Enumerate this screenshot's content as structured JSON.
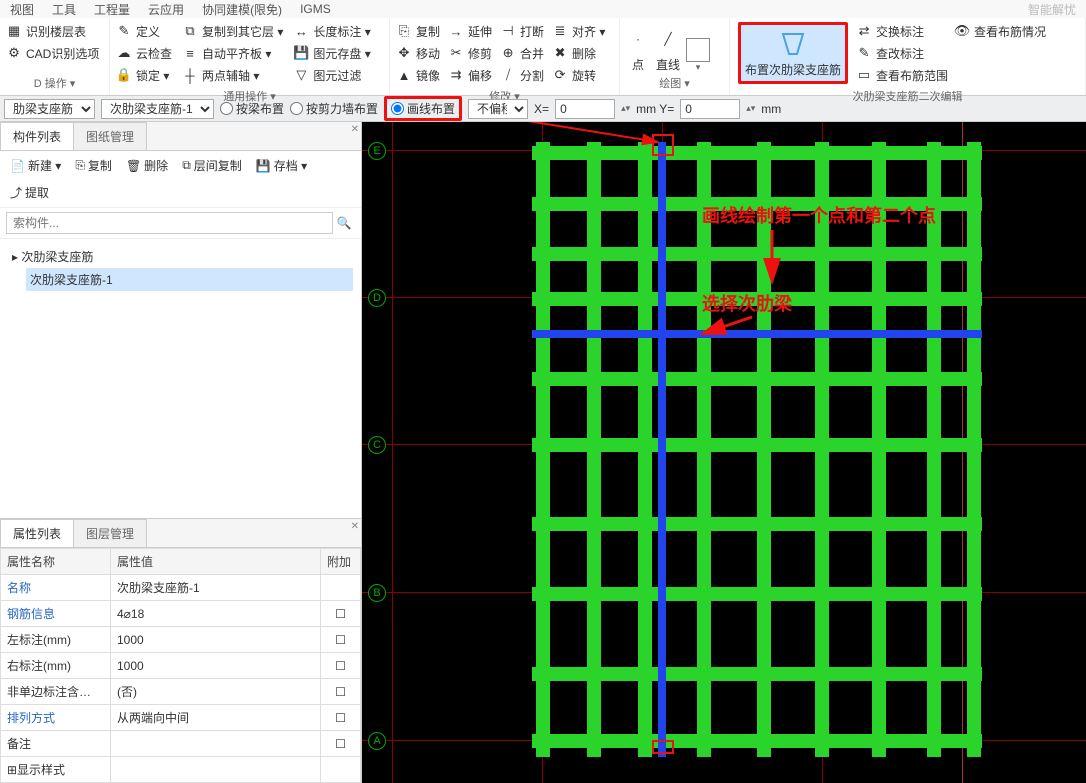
{
  "menu": {
    "m1": "视图",
    "m2": "工具",
    "m3": "工程量",
    "m4": "云应用",
    "m5": "协同建模(限免)",
    "m6": "IGMS",
    "tr": "智能解忧"
  },
  "ribbon": {
    "col1": {
      "a": "识别楼层表",
      "b": "CAD识别选项",
      "label": "D 操作 ▾"
    },
    "col2": {
      "a": "定义",
      "b": "云检查",
      "c": "锁定 ▾",
      "d": "复制到其它层 ▾",
      "e": "自动平齐板 ▾",
      "f": "两点辅轴 ▾",
      "g": "长度标注 ▾",
      "h": "图元存盘 ▾",
      "i": "图元过滤",
      "label": "通用操作 ▾"
    },
    "col3": {
      "a": "复制",
      "b": "移动",
      "c": "镜像",
      "d": "延伸",
      "e": "修剪",
      "f": "偏移",
      "g": "打断",
      "h": "合并",
      "i": "分割",
      "j": "对齐 ▾",
      "k": "删除",
      "l": "旋转",
      "label": "修改 ▾"
    },
    "col4": {
      "a": "点",
      "b": "直线",
      "c": "□",
      "label": "绘图 ▾"
    },
    "col5": {
      "big": "布置次肋梁支座筋",
      "a": "交换标注",
      "b": "查改标注",
      "c": "查看布筋范围",
      "d": "查看布筋情况",
      "label": "次肋梁支座筋二次编辑"
    }
  },
  "opt": {
    "sel1": "肋梁支座筋",
    "sel2": "次肋梁支座筋-1",
    "r1": "按梁布置",
    "r2": "按剪力墙布置",
    "r3": "画线布置",
    "offset": "不偏移",
    "xl": "X=",
    "xv": "0",
    "yl": "mm Y=",
    "yv": "0",
    "mm": "mm"
  },
  "left": {
    "tab1": "构件列表",
    "tab2": "图纸管理",
    "tb": {
      "new": "新建 ▾",
      "copy": "复制",
      "del": "删除",
      "layer": "层间复制",
      "arch": "存档 ▾",
      "ext": "提取"
    },
    "searchPH": "索构件...",
    "tree": {
      "root": "次肋梁支座筋",
      "child": "次肋梁支座筋-1"
    },
    "ptab1": "属性列表",
    "ptab2": "图层管理",
    "hdrs": {
      "name": "属性名称",
      "val": "属性值",
      "add": "附加"
    },
    "rows": [
      {
        "n": "名称",
        "v": "次肋梁支座筋-1",
        "link": true,
        "chk": ""
      },
      {
        "n": "钢筋信息",
        "v": "4⌀18",
        "link": true,
        "chk": "☐"
      },
      {
        "n": "左标注(mm)",
        "v": "1000",
        "chk": "☐"
      },
      {
        "n": "右标注(mm)",
        "v": "1000",
        "chk": "☐"
      },
      {
        "n": "非单边标注含…",
        "v": "(否)",
        "chk": "☐"
      },
      {
        "n": "排列方式",
        "v": "从两端向中间",
        "link": true,
        "chk": "☐"
      },
      {
        "n": "备注",
        "v": "",
        "chk": "☐"
      },
      {
        "n": "显示样式",
        "v": "",
        "pre": "⊞",
        "chk": ""
      }
    ]
  },
  "canvas": {
    "rows": [
      "E",
      "D",
      "C",
      "B",
      "A"
    ],
    "anno1": "画线绘制第一个点和第二个点",
    "anno2": "选择次肋梁"
  }
}
